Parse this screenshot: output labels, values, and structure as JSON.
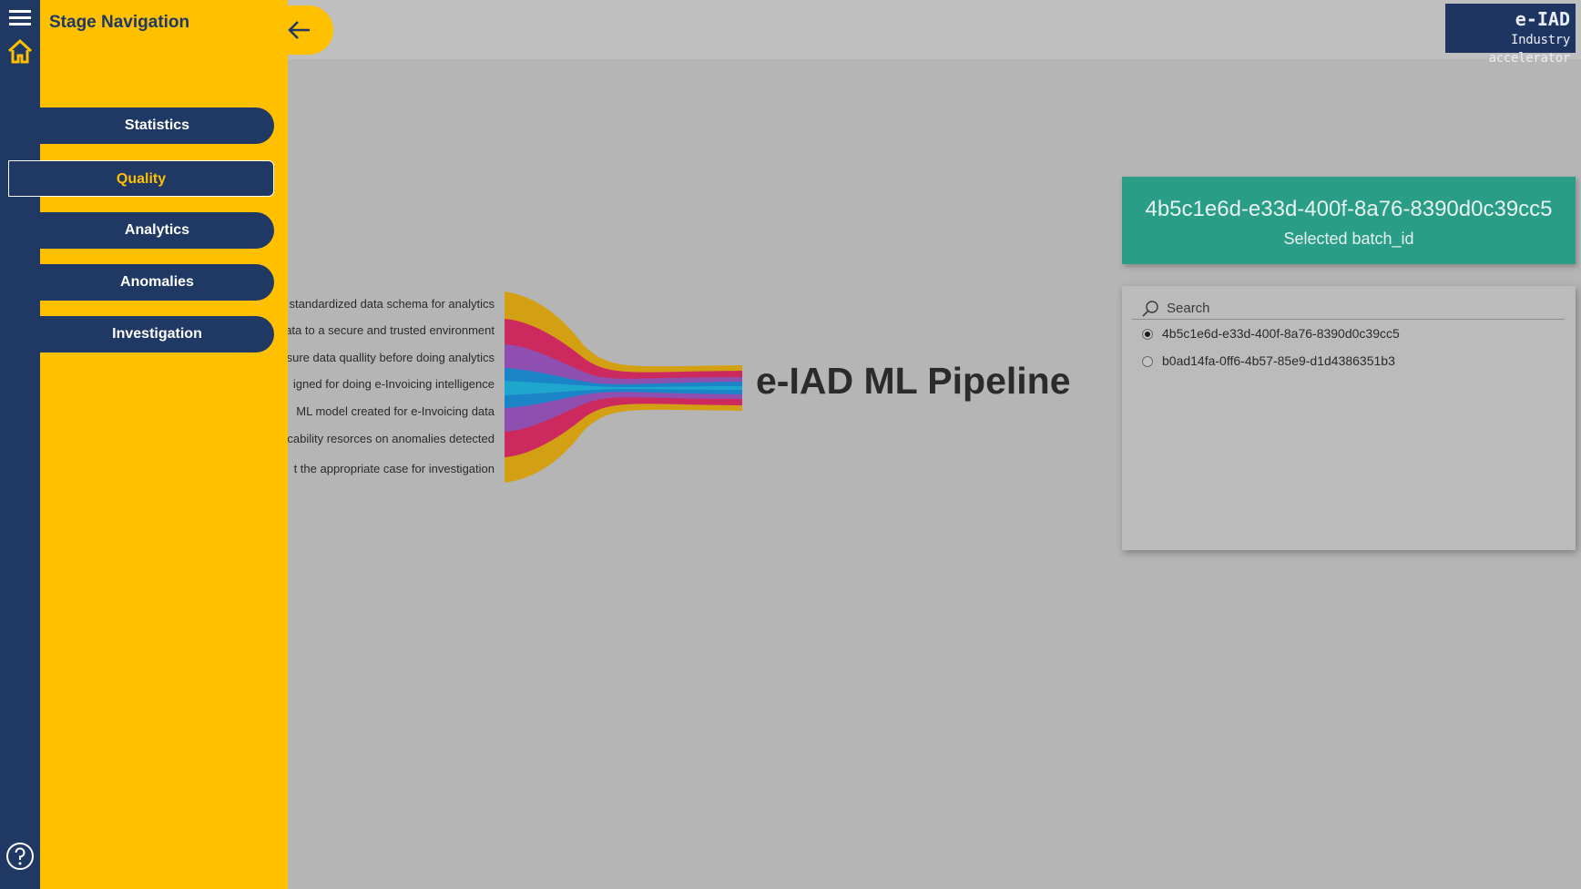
{
  "panel": {
    "title": "Stage Navigation"
  },
  "nav": {
    "items": [
      {
        "label": "Statistics",
        "active": false
      },
      {
        "label": "Quality",
        "active": true
      },
      {
        "label": "Analytics",
        "active": false
      },
      {
        "label": "Anomalies",
        "active": false
      },
      {
        "label": "Investigation",
        "active": false
      }
    ]
  },
  "icons": {
    "menu": "hamburger-menu-icon",
    "home": "home-icon",
    "back": "arrow-left-icon",
    "help": "question-mark-icon",
    "search": "search-icon"
  },
  "logo": {
    "line1": "e-IAD",
    "line2": "Industry accelerator"
  },
  "pipeline": {
    "title": "e-IAD ML Pipeline",
    "steps": [
      "a standardized data schema for analytics",
      "ata to a secure and trusted environment",
      "sure data quallity before doing analytics",
      "igned for doing e-Invoicing intelligence",
      "ML model created for e-Invoicing data",
      "cability resorces on anomalies detected",
      "t the appropriate case for investigation"
    ],
    "colors": [
      "#d4a013",
      "#cc2a5f",
      "#8e4fb0",
      "#1a84c7"
    ]
  },
  "batch": {
    "value": "4b5c1e6d-e33d-400f-8a76-8390d0c39cc5",
    "label": "Selected batch_id"
  },
  "slicer": {
    "search_placeholder": "Search",
    "options": [
      {
        "label": "4b5c1e6d-e33d-400f-8a76-8390d0c39cc5",
        "selected": true
      },
      {
        "label": "b0ad14fa-0ff6-4b57-85e9-d1d4386351b3",
        "selected": false
      }
    ]
  },
  "colors": {
    "navy": "#1f3864",
    "amber": "#ffc000",
    "teal": "#2a9d86",
    "canvas": "#b5b5b5"
  }
}
